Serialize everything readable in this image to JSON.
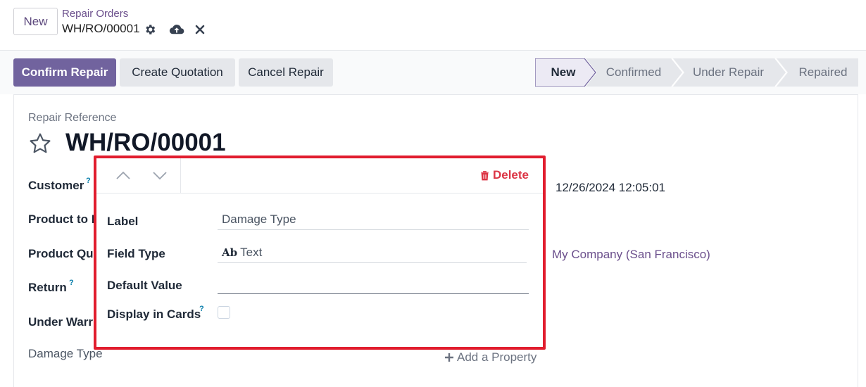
{
  "breadcrumb": {
    "new_label": "New",
    "parent": "Repair Orders",
    "current": "WH/RO/00001"
  },
  "actions": {
    "confirm": "Confirm Repair",
    "quotation": "Create Quotation",
    "cancel": "Cancel Repair"
  },
  "statusbar": {
    "stages": [
      "New",
      "Confirmed",
      "Under Repair",
      "Repaired"
    ],
    "active": "New"
  },
  "form": {
    "ref_label": "Repair Reference",
    "ref_value": "WH/RO/00001",
    "fields": {
      "customer": "Customer",
      "product": "Product to R",
      "quantity": "Product Qu",
      "return": "Return",
      "warranty": "Under Warr",
      "damage": "Damage Type"
    },
    "help_mark": "?",
    "scheduled_date": "12/26/2024 12:05:01",
    "company": "My Company (San Francisco)",
    "add_property": "Add a Property"
  },
  "popover": {
    "delete_label": "Delete",
    "label_label": "Label",
    "label_value": "Damage Type",
    "field_type_label": "Field Type",
    "field_type_icon": "Ab",
    "field_type_value": "Text",
    "default_label": "Default Value",
    "default_value": "",
    "display_cards_label": "Display in Cards"
  },
  "colors": {
    "brand": "#71639e",
    "highlight": "#e11d2e",
    "delete": "#dc3545",
    "link": "#6b4f8c"
  }
}
